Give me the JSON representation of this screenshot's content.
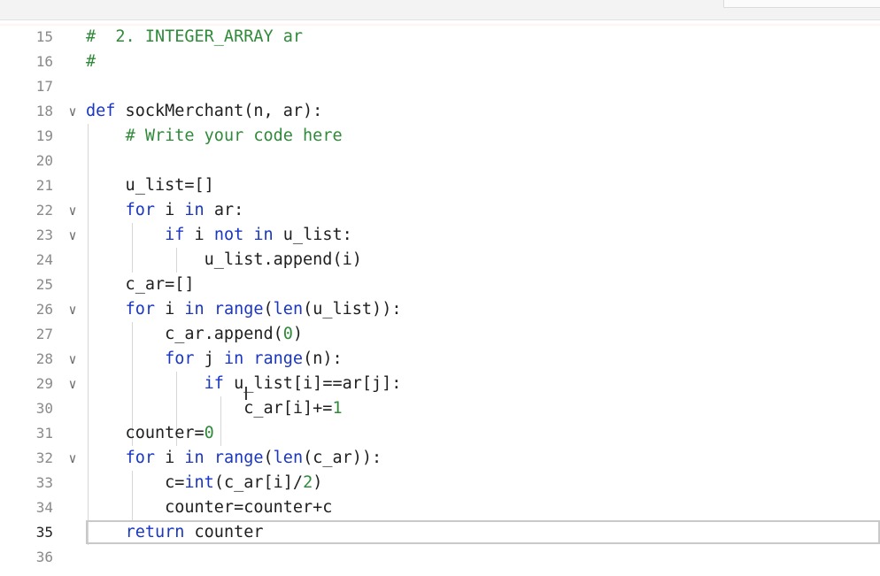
{
  "editor": {
    "active_line": "35",
    "lines": [
      {
        "num": "15",
        "tokens": [
          {
            "t": "#  2. INTEGER_ARRAY ar",
            "c": "cm"
          }
        ]
      },
      {
        "num": "16",
        "tokens": [
          {
            "t": "#",
            "c": "cm"
          }
        ]
      },
      {
        "num": "17",
        "tokens": []
      },
      {
        "num": "18",
        "fold": true,
        "tokens": [
          {
            "t": "def",
            "c": "kw"
          },
          {
            "t": " sockMerchant(n, ar):",
            "c": ""
          }
        ]
      },
      {
        "num": "19",
        "tokens": [
          {
            "t": "    "
          },
          {
            "t": "# Write your code here",
            "c": "cm"
          }
        ]
      },
      {
        "num": "20",
        "tokens": []
      },
      {
        "num": "21",
        "tokens": [
          {
            "t": "    u_list=[]"
          }
        ]
      },
      {
        "num": "22",
        "fold": true,
        "tokens": [
          {
            "t": "    "
          },
          {
            "t": "for",
            "c": "kw"
          },
          {
            "t": " i "
          },
          {
            "t": "in",
            "c": "kw"
          },
          {
            "t": " ar:"
          }
        ]
      },
      {
        "num": "23",
        "fold": true,
        "tokens": [
          {
            "t": "        "
          },
          {
            "t": "if",
            "c": "kw"
          },
          {
            "t": " i "
          },
          {
            "t": "not",
            "c": "kw"
          },
          {
            "t": " "
          },
          {
            "t": "in",
            "c": "kw"
          },
          {
            "t": " u_list:"
          }
        ]
      },
      {
        "num": "24",
        "tokens": [
          {
            "t": "            u_list.append(i)"
          }
        ]
      },
      {
        "num": "25",
        "tokens": [
          {
            "t": "    c_ar=[]"
          }
        ]
      },
      {
        "num": "26",
        "fold": true,
        "tokens": [
          {
            "t": "    "
          },
          {
            "t": "for",
            "c": "kw"
          },
          {
            "t": " i "
          },
          {
            "t": "in",
            "c": "kw"
          },
          {
            "t": " "
          },
          {
            "t": "range",
            "c": "kw"
          },
          {
            "t": "("
          },
          {
            "t": "len",
            "c": "kw"
          },
          {
            "t": "(u_list)):"
          }
        ]
      },
      {
        "num": "27",
        "tokens": [
          {
            "t": "        c_ar.append("
          },
          {
            "t": "0",
            "c": "nu"
          },
          {
            "t": ")"
          }
        ]
      },
      {
        "num": "28",
        "fold": true,
        "tokens": [
          {
            "t": "        "
          },
          {
            "t": "for",
            "c": "kw"
          },
          {
            "t": " j "
          },
          {
            "t": "in",
            "c": "kw"
          },
          {
            "t": " "
          },
          {
            "t": "range",
            "c": "kw"
          },
          {
            "t": "(n):"
          }
        ]
      },
      {
        "num": "29",
        "fold": true,
        "tokens": [
          {
            "t": "            "
          },
          {
            "t": "if",
            "c": "kw"
          },
          {
            "t": " u_list[i]==ar[j]:"
          }
        ]
      },
      {
        "num": "30",
        "tokens": [
          {
            "t": "                c_ar[i]+="
          },
          {
            "t": "1",
            "c": "nu"
          }
        ]
      },
      {
        "num": "31",
        "tokens": [
          {
            "t": "    counter="
          },
          {
            "t": "0",
            "c": "nu"
          }
        ]
      },
      {
        "num": "32",
        "fold": true,
        "tokens": [
          {
            "t": "    "
          },
          {
            "t": "for",
            "c": "kw"
          },
          {
            "t": " i "
          },
          {
            "t": "in",
            "c": "kw"
          },
          {
            "t": " "
          },
          {
            "t": "range",
            "c": "kw"
          },
          {
            "t": "("
          },
          {
            "t": "len",
            "c": "kw"
          },
          {
            "t": "(c_ar)):"
          }
        ]
      },
      {
        "num": "33",
        "tokens": [
          {
            "t": "        c="
          },
          {
            "t": "int",
            "c": "kw"
          },
          {
            "t": "(c_ar[i]/"
          },
          {
            "t": "2",
            "c": "nu"
          },
          {
            "t": ")"
          }
        ]
      },
      {
        "num": "34",
        "tokens": [
          {
            "t": "        counter=counter+c"
          }
        ]
      },
      {
        "num": "35",
        "tokens": [
          {
            "t": "    "
          },
          {
            "t": "return",
            "c": "kw"
          },
          {
            "t": " counter"
          }
        ]
      },
      {
        "num": "36",
        "tokens": []
      }
    ]
  },
  "icons": {
    "fold": "chevron-down-icon",
    "cursor": "text-cursor-icon"
  },
  "colors": {
    "keyword": "#1a37c4",
    "comment": "#2f8b3a",
    "number": "#2f8b3a",
    "line_number": "#8a8a8a",
    "text": "#1f1f1f"
  }
}
